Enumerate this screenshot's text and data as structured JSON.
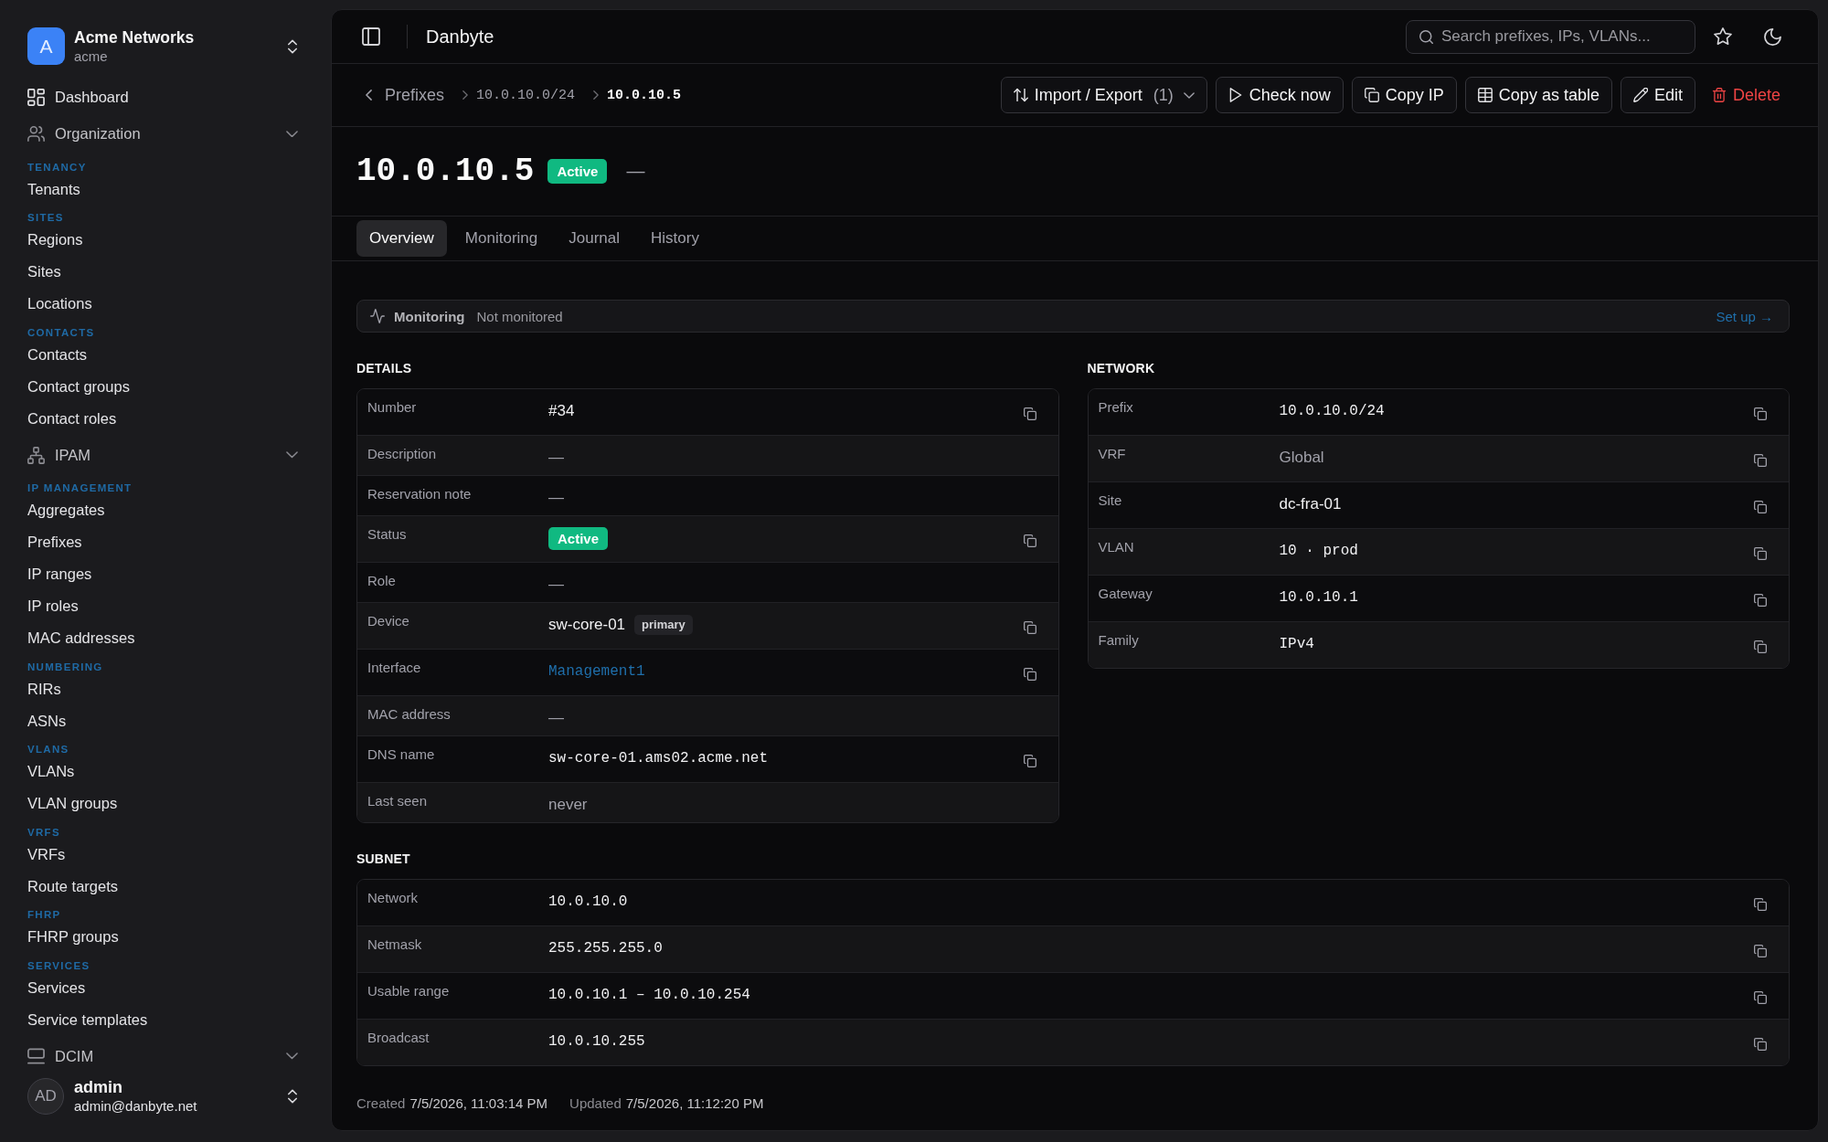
{
  "sidebar": {
    "workspace": {
      "initial": "A",
      "name": "Acme Networks",
      "slug": "acme"
    },
    "nav": [
      {
        "kind": "link",
        "label": "Dashboard",
        "selected": false
      },
      {
        "kind": "group",
        "label": "Organization",
        "sections": [
          {
            "heading": "TENANCY",
            "items": [
              {
                "label": "Tenants",
                "selected": false
              }
            ]
          },
          {
            "heading": "SITES",
            "items": [
              {
                "label": "Regions",
                "selected": false
              },
              {
                "label": "Sites",
                "selected": false
              },
              {
                "label": "Locations",
                "selected": false
              }
            ]
          },
          {
            "heading": "CONTACTS",
            "items": [
              {
                "label": "Contacts",
                "selected": false
              },
              {
                "label": "Contact groups",
                "selected": false
              },
              {
                "label": "Contact roles",
                "selected": false
              }
            ]
          }
        ]
      },
      {
        "kind": "group",
        "label": "IPAM",
        "sections": [
          {
            "heading": "IP MANAGEMENT",
            "items": [
              {
                "label": "Aggregates",
                "selected": false
              },
              {
                "label": "Prefixes",
                "selected": false
              },
              {
                "label": "IP ranges",
                "selected": false
              },
              {
                "label": "IP roles",
                "selected": false
              },
              {
                "label": "MAC addresses",
                "selected": false
              }
            ]
          },
          {
            "heading": "NUMBERING",
            "items": [
              {
                "label": "RIRs",
                "selected": false
              },
              {
                "label": "ASNs",
                "selected": false
              }
            ]
          },
          {
            "heading": "VLANS",
            "items": [
              {
                "label": "VLANs",
                "selected": false
              },
              {
                "label": "VLAN groups",
                "selected": false
              }
            ]
          },
          {
            "heading": "VRFS",
            "items": [
              {
                "label": "VRFs",
                "selected": false
              },
              {
                "label": "Route targets",
                "selected": false
              }
            ]
          },
          {
            "heading": "FHRP",
            "items": [
              {
                "label": "FHRP groups",
                "selected": false
              }
            ]
          },
          {
            "heading": "SERVICES",
            "items": [
              {
                "label": "Services",
                "selected": false
              },
              {
                "label": "Service templates",
                "selected": false
              }
            ]
          }
        ]
      },
      {
        "kind": "group",
        "label": "DCIM"
      }
    ],
    "user": {
      "initials": "AD",
      "name": "admin",
      "email": "admin@danbyte.net"
    }
  },
  "topbar": {
    "title": "Danbyte",
    "search": {
      "placeholder": "Search prefixes, IPs, VLANs..."
    }
  },
  "breadcrumb": {
    "back": "Prefixes",
    "trail": [
      {
        "label": "10.0.10.0/24",
        "current": false
      },
      {
        "label": "10.0.10.5",
        "current": true
      }
    ]
  },
  "actions": [
    {
      "kind": "dropdown",
      "label": "Import / Export",
      "count": "(1)"
    },
    {
      "kind": "button",
      "label": "Check now"
    },
    {
      "kind": "button",
      "label": "Copy IP"
    },
    {
      "kind": "button",
      "label": "Copy as table"
    },
    {
      "kind": "button",
      "label": "Edit"
    },
    {
      "kind": "danger",
      "label": "Delete"
    }
  ],
  "title": {
    "address": "10.0.10.5",
    "status": "Active",
    "note": "—"
  },
  "tabs": [
    {
      "label": "Overview",
      "selected": true
    },
    {
      "label": "Monitoring",
      "selected": false
    },
    {
      "label": "Journal",
      "selected": false
    },
    {
      "label": "History",
      "selected": false
    }
  ],
  "monitoring": {
    "label": "Monitoring",
    "status": "Not monitored",
    "link": "Set up →"
  },
  "details": {
    "heading": "DETAILS",
    "rows": [
      {
        "label": "Number",
        "value": "#34",
        "kind": "text",
        "copyable": true
      },
      {
        "label": "Description",
        "value": "—",
        "kind": "muted",
        "copyable": false
      },
      {
        "label": "Reservation note",
        "value": "—",
        "kind": "muted",
        "copyable": false
      },
      {
        "label": "Status",
        "value": "Active",
        "kind": "badge",
        "copyable": true
      },
      {
        "label": "Role",
        "value": "—",
        "kind": "muted",
        "copyable": false
      },
      {
        "label": "Device",
        "value": "sw-core-01",
        "kind": "text",
        "tag": "primary",
        "copyable": true
      },
      {
        "label": "Interface",
        "value": "Management1",
        "kind": "link",
        "copyable": true
      },
      {
        "label": "MAC address",
        "value": "—",
        "kind": "muted",
        "copyable": false
      },
      {
        "label": "DNS name",
        "value": "sw-core-01.ams02.acme.net",
        "kind": "mono",
        "copyable": true
      },
      {
        "label": "Last seen",
        "value": "never",
        "kind": "muted",
        "copyable": false
      }
    ]
  },
  "network": {
    "heading": "NETWORK",
    "rows": [
      {
        "label": "Prefix",
        "value": "10.0.10.0/24",
        "kind": "mono",
        "copyable": true
      },
      {
        "label": "VRF",
        "value": "Global",
        "kind": "muted",
        "copyable": true
      },
      {
        "label": "Site",
        "value": "dc-fra-01",
        "kind": "text",
        "copyable": true
      },
      {
        "label": "VLAN",
        "value": "10 · prod",
        "kind": "mono",
        "copyable": true
      },
      {
        "label": "Gateway",
        "value": "10.0.10.1",
        "kind": "mono",
        "copyable": true
      },
      {
        "label": "Family",
        "value": "IPv4",
        "kind": "mono",
        "copyable": true
      }
    ]
  },
  "subnet": {
    "heading": "SUBNET",
    "rows": [
      {
        "label": "Network",
        "value": "10.0.10.0",
        "kind": "mono",
        "copyable": true
      },
      {
        "label": "Netmask",
        "value": "255.255.255.0",
        "kind": "mono",
        "copyable": true
      },
      {
        "label": "Usable range",
        "value": "10.0.10.1 – 10.0.10.254",
        "kind": "mono",
        "copyable": true
      },
      {
        "label": "Broadcast",
        "value": "10.0.10.255",
        "kind": "mono",
        "copyable": true
      }
    ]
  },
  "timestamps": [
    {
      "label": "Created",
      "value": "7/5/2026, 11:03:14 PM"
    },
    {
      "label": "Updated",
      "value": "7/5/2026, 11:12:20 PM"
    }
  ]
}
